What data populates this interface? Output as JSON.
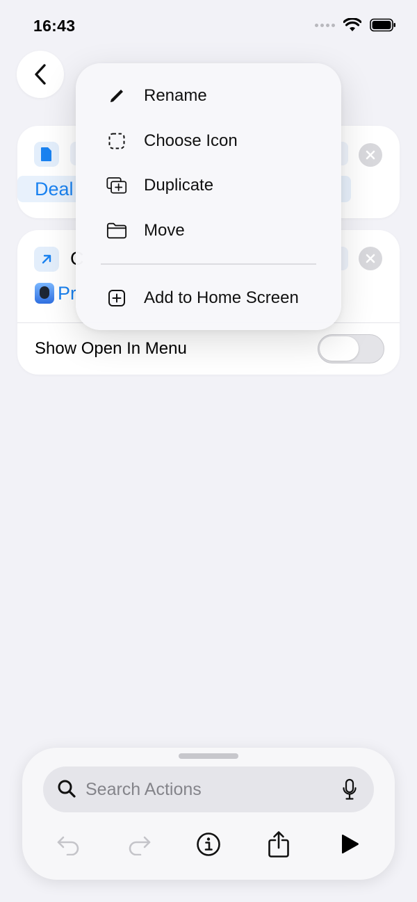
{
  "status_bar": {
    "time": "16:43"
  },
  "menu": {
    "items": [
      {
        "label": "Rename",
        "icon": "pencil-icon"
      },
      {
        "label": "Choose Icon",
        "icon": "dashed-square-icon"
      },
      {
        "label": "Duplicate",
        "icon": "duplicate-icon"
      },
      {
        "label": "Move",
        "icon": "folder-icon"
      },
      {
        "label": "Add to Home Screen",
        "icon": "plus-square-icon"
      }
    ]
  },
  "cards": {
    "first": {
      "visible_text": "Deal"
    },
    "second": {
      "visible_text_top": "C",
      "visible_text_app": "Pr"
    }
  },
  "settings": {
    "show_open_in_menu": {
      "label": "Show Open In Menu",
      "enabled": false
    }
  },
  "action_panel": {
    "search_placeholder": "Search Actions"
  },
  "colors": {
    "accent": "#1a82f0",
    "background": "#f2f2f7"
  }
}
